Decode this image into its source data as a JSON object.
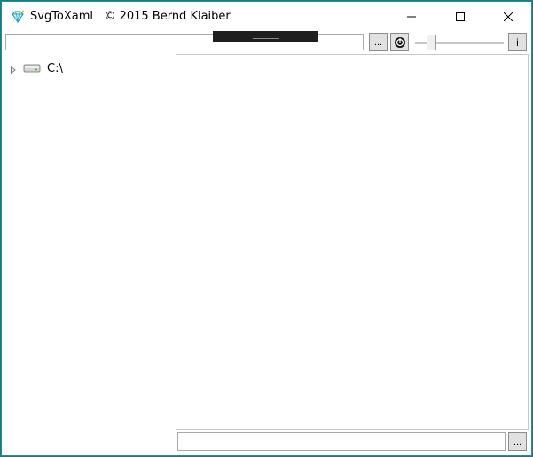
{
  "window": {
    "title": "SvgToXaml",
    "copyright": "© 2015 Bernd Klaiber",
    "icon": "diamond-icon"
  },
  "window_controls": {
    "minimize_icon": "minimize-icon",
    "maximize_icon": "maximize-icon",
    "close_icon": "close-icon"
  },
  "toolbar": {
    "path_value": "",
    "browse_label": "...",
    "refresh_icon": "refresh-icon",
    "zoom_level": 0.15,
    "info_label": "i"
  },
  "tree": {
    "items": [
      {
        "label": "C:\\",
        "icon": "drive-icon",
        "expander": "expand-triangle-icon"
      }
    ]
  },
  "bottom": {
    "path_value": "",
    "browse_label": "..."
  },
  "colors": {
    "frame": "#1a7a82",
    "button_bg": "#e1e1e1",
    "border": "#a9a9a9"
  }
}
